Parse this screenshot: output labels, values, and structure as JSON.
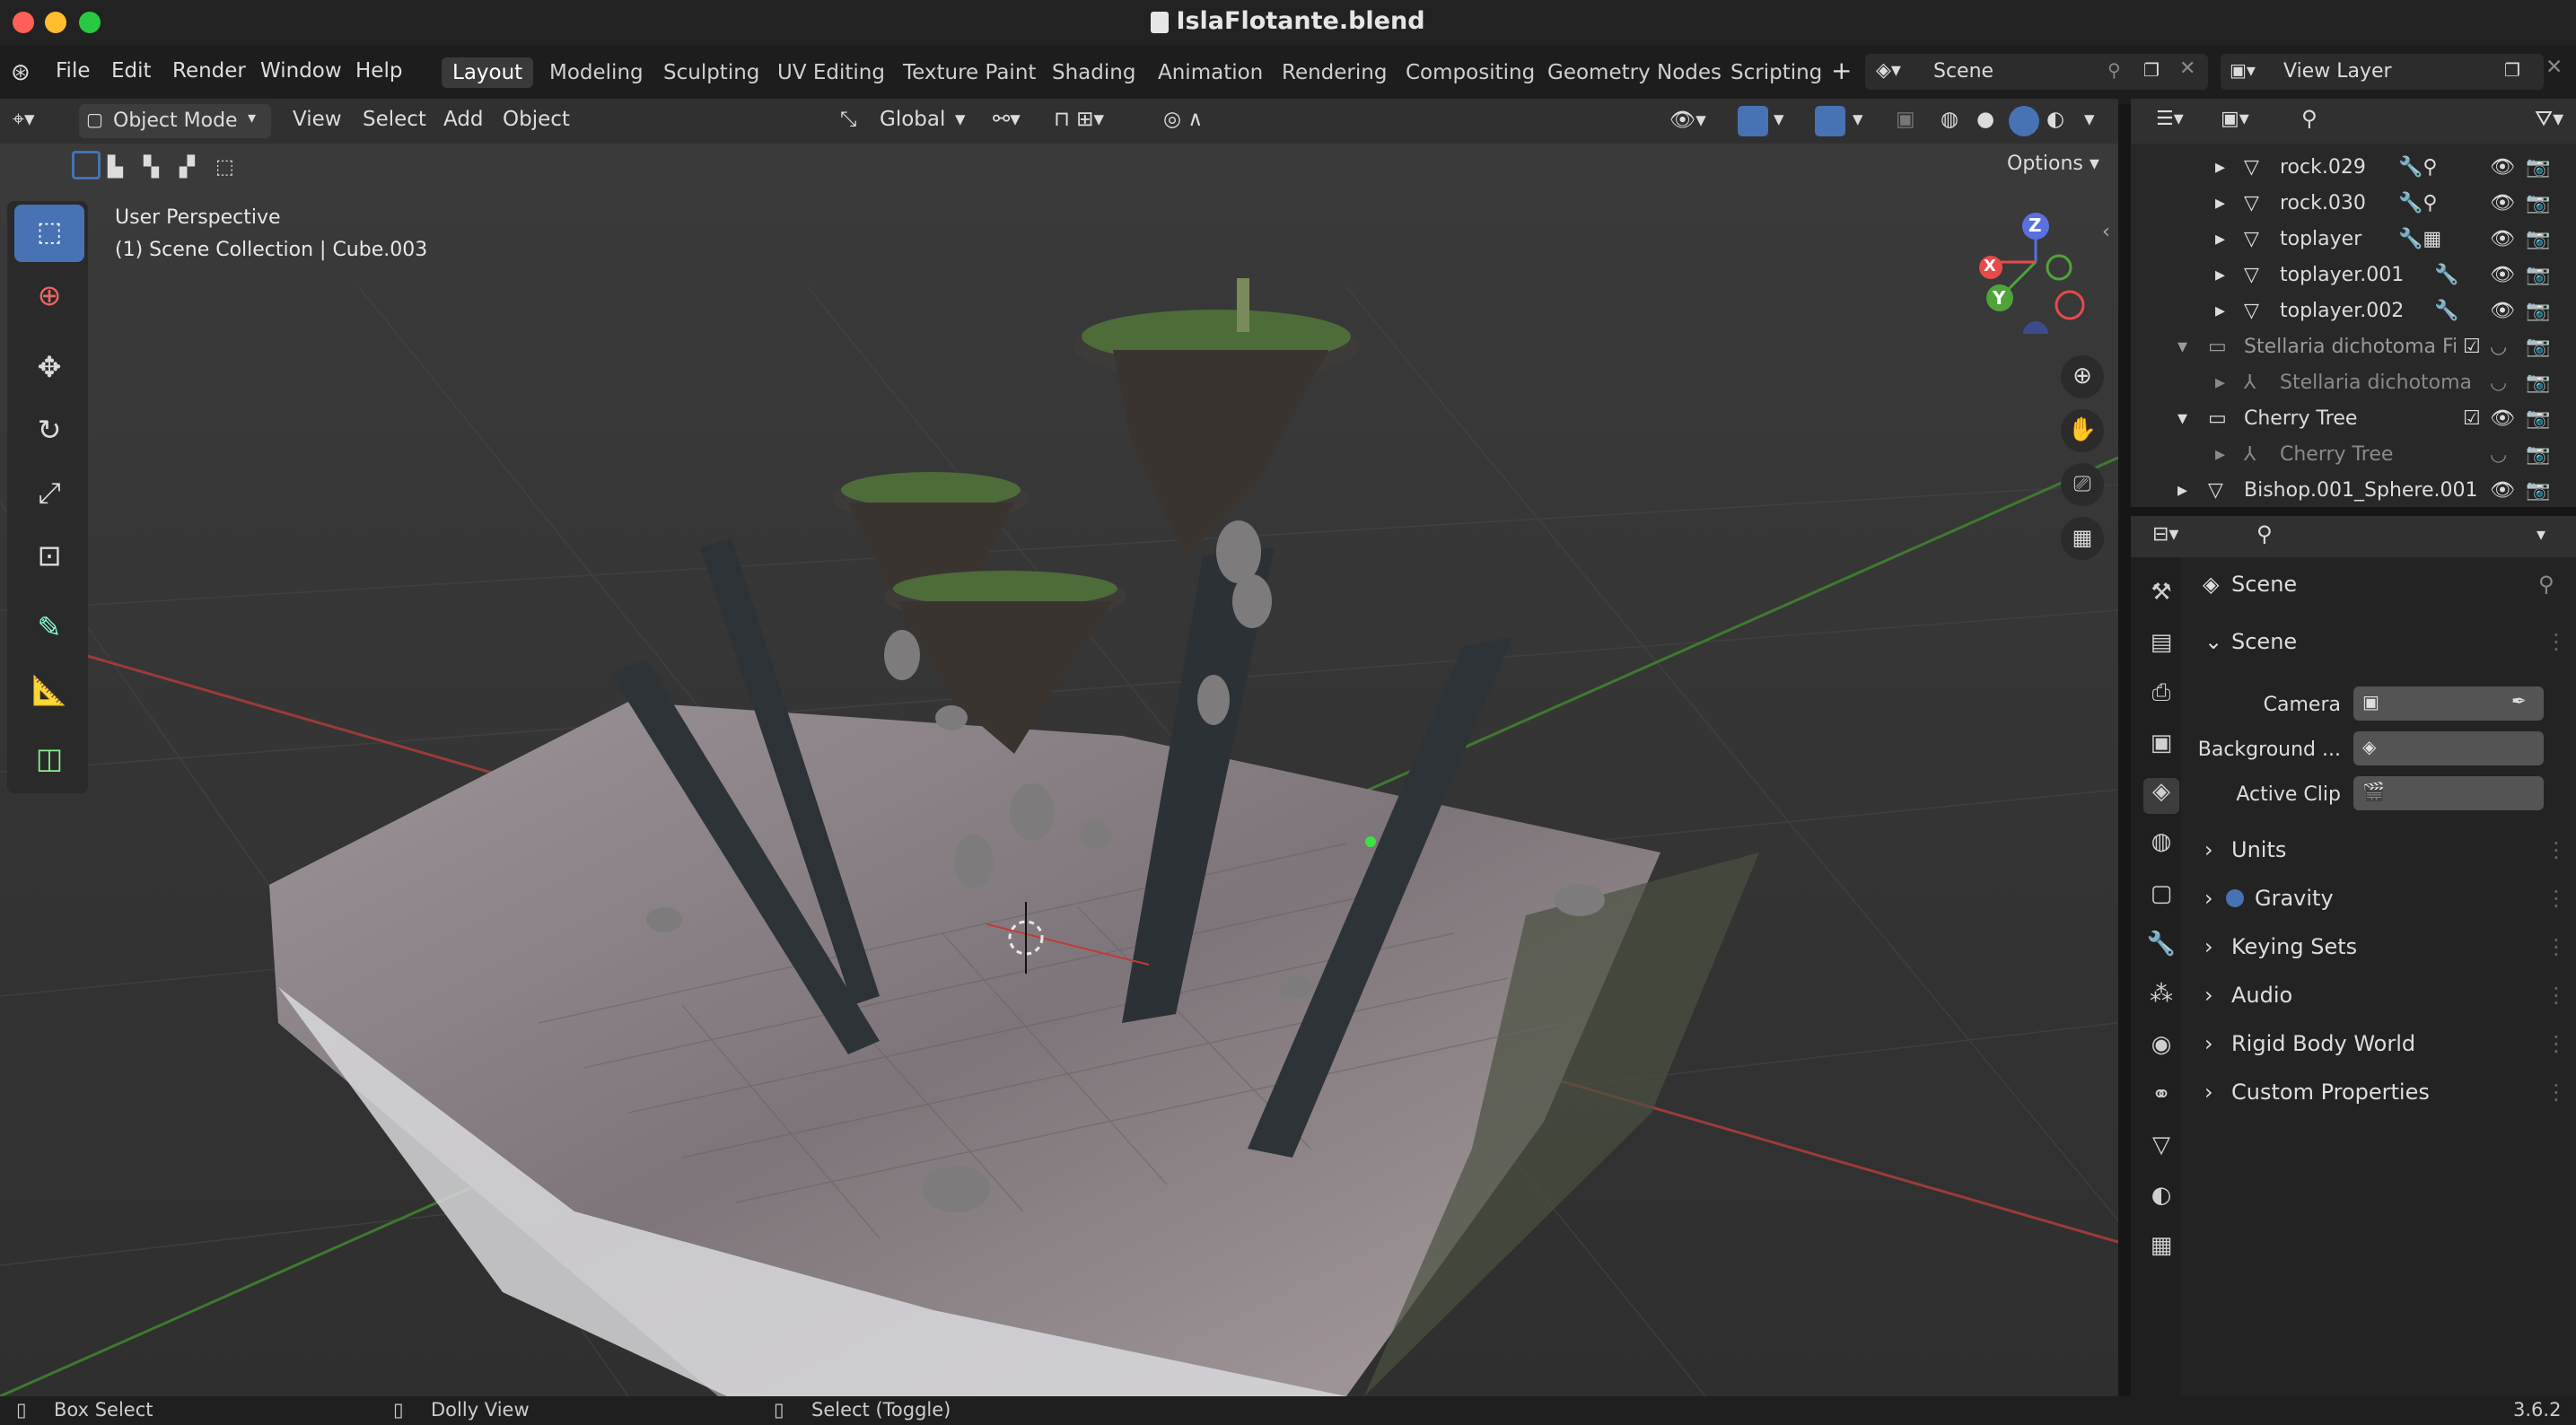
{
  "window": {
    "title": "IslaFlotante.blend"
  },
  "menu": [
    "File",
    "Edit",
    "Render",
    "Window",
    "Help"
  ],
  "workspaces": [
    "Layout",
    "Modeling",
    "Sculpting",
    "UV Editing",
    "Texture Paint",
    "Shading",
    "Animation",
    "Rendering",
    "Compositing",
    "Geometry Nodes",
    "Scripting"
  ],
  "active_workspace": "Layout",
  "scene_selector": {
    "label": "Scene"
  },
  "viewlayer_selector": {
    "label": "View Layer"
  },
  "viewport_header": {
    "mode": "Object Mode",
    "menus": [
      "View",
      "Select",
      "Add",
      "Object"
    ],
    "orientation": "Global",
    "options": "Options"
  },
  "viewport": {
    "perspective": "User Perspective",
    "collection": "(1) Scene Collection | Cube.003",
    "gizmo": {
      "z": "Z",
      "y": "Y",
      "x": "X"
    }
  },
  "outliner": {
    "rows": [
      {
        "name": "rock.029",
        "indent": 1
      },
      {
        "name": "rock.030",
        "indent": 1
      },
      {
        "name": "toplayer",
        "indent": 1
      },
      {
        "name": "toplayer.001",
        "indent": 1
      },
      {
        "name": "toplayer.002",
        "indent": 1
      },
      {
        "name": "Stellaria dichotoma Field",
        "indent": 0,
        "dim": true
      },
      {
        "name": "Stellaria dichotoma",
        "indent": 1,
        "dim": true
      },
      {
        "name": "Cherry Tree",
        "indent": 0
      },
      {
        "name": "Cherry Tree",
        "indent": 1,
        "dim": true
      },
      {
        "name": "Bishop.001_Sphere.001",
        "indent": 0
      }
    ]
  },
  "properties": {
    "header": "Scene",
    "section": "Scene",
    "fields": [
      {
        "label": "Camera"
      },
      {
        "label": "Background ..."
      },
      {
        "label": "Active Clip"
      }
    ],
    "panels": [
      "Units",
      "Gravity",
      "Keying Sets",
      "Audio",
      "Rigid Body World",
      "Custom Properties"
    ]
  },
  "status": {
    "left": "Box Select",
    "middle": "Dolly View",
    "right": "Select (Toggle)",
    "version": "3.6.2"
  },
  "colors": {
    "accent": "#4772b3",
    "x_axis": "#e84a4a",
    "y_axis": "#4fa33a",
    "z_axis": "#5a6fe0"
  }
}
